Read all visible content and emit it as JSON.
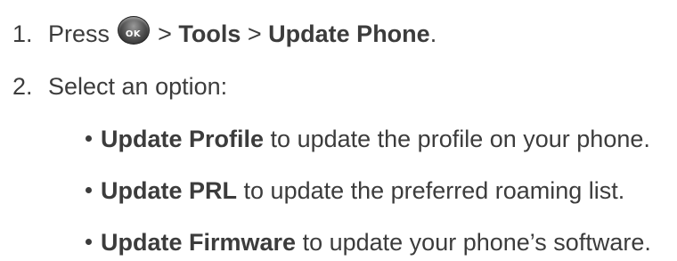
{
  "step1": {
    "number": "1.",
    "press": "Press",
    "ok_icon_label": "OK",
    "sep1": ">",
    "tools": "Tools",
    "sep2": ">",
    "update_phone": "Update Phone",
    "period": "."
  },
  "step2": {
    "number": "2.",
    "text": "Select an option:"
  },
  "options": [
    {
      "bold": "Update Profile",
      "text": "to update the profile on your phone."
    },
    {
      "bold": "Update PRL",
      "text": "to update the preferred roaming list."
    },
    {
      "bold": "Update Firmware",
      "text": "to update your phone’s software."
    }
  ],
  "icons": {
    "ok_key": "ok-key-icon",
    "bullet": "bullet-dot-icon"
  },
  "colors": {
    "text": "#3c3c3c",
    "ok_key": "#4a4a4a"
  }
}
